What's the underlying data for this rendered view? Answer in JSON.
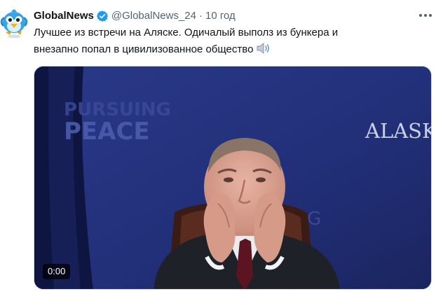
{
  "tweet": {
    "author_name": "GlobalNews",
    "handle": "@GlobalNews_24",
    "separator": "·",
    "time": "10 год",
    "text_line1": "Лучшее из встречи на Аляске. Одичалый выполз из бункера и",
    "text_line2": "внезапно попал в цивилизованное общество"
  },
  "icons": {
    "avatar": "bird-avatar-icon",
    "verified": "verified-badge-icon",
    "speaker": "speaker-icon",
    "more": "more-dots-icon"
  },
  "media": {
    "duration": "0:00",
    "backdrop_text_left_1": "PURSUING",
    "backdrop_text_left_2": "PEACE",
    "backdrop_text_right": "ALASKA",
    "backdrop_text_center": "ING"
  },
  "colors": {
    "verified": "#1d9bf0",
    "backdrop": "#1f2c70",
    "muted_text": "#536471"
  }
}
